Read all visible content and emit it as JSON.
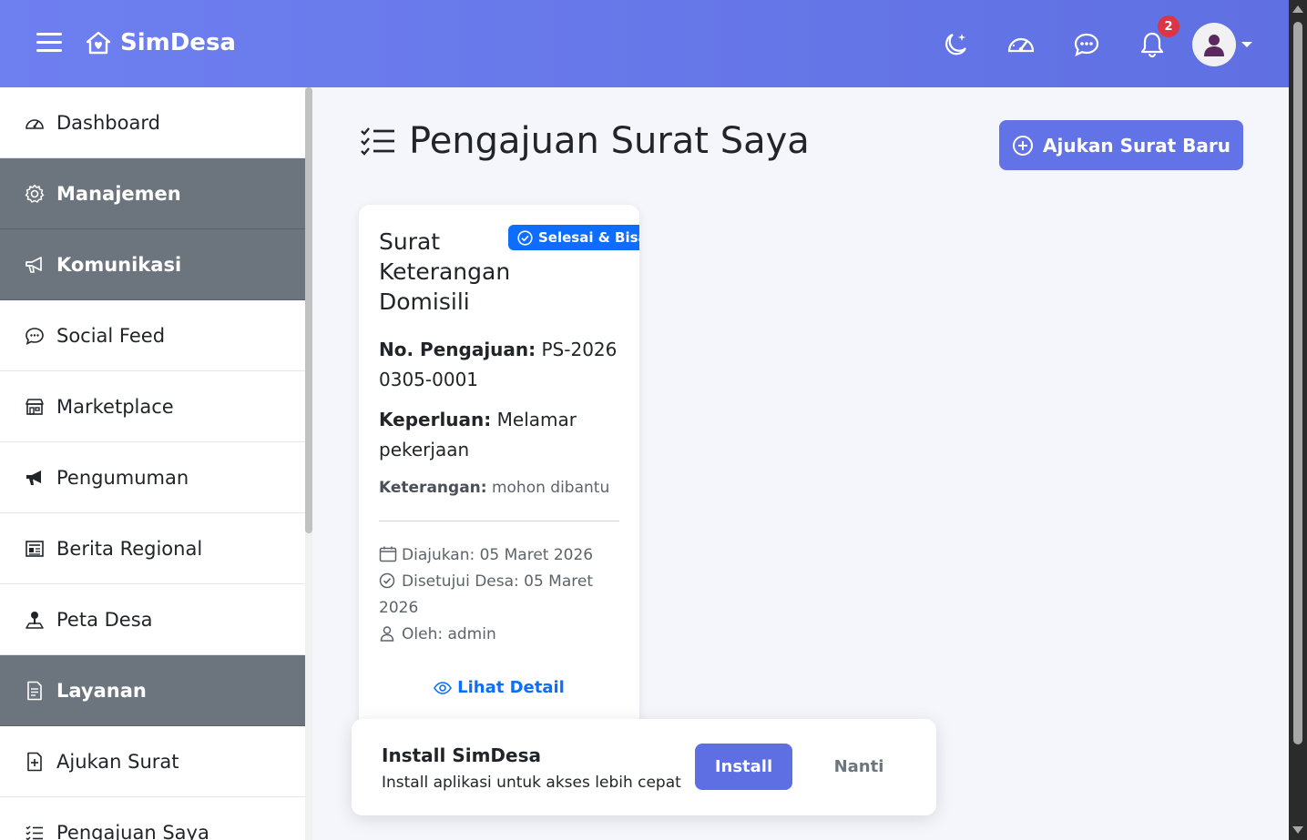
{
  "navbar": {
    "brand": "SimDesa",
    "notification_count": "2",
    "icons": [
      "menu-icon",
      "home-heart-icon",
      "moon-stars-icon",
      "speedometer-icon",
      "chat-dots-icon",
      "bell-icon",
      "user-avatar-icon"
    ],
    "accent_color": "#6173e6"
  },
  "sidebar": {
    "items": [
      {
        "label": "Dashboard",
        "icon": "speedometer-icon",
        "type": "link"
      },
      {
        "label": "Manajemen",
        "icon": "gear-icon",
        "type": "header"
      },
      {
        "label": "Komunikasi",
        "icon": "megaphone-icon",
        "type": "header"
      },
      {
        "label": "Social Feed",
        "icon": "chat-dots-icon",
        "type": "link"
      },
      {
        "label": "Marketplace",
        "icon": "shop-icon",
        "type": "link"
      },
      {
        "label": "Pengumuman",
        "icon": "megaphone-fill-icon",
        "type": "link"
      },
      {
        "label": "Berita Regional",
        "icon": "newspaper-icon",
        "type": "link"
      },
      {
        "label": "Peta Desa",
        "icon": "person-pin-icon",
        "type": "link"
      },
      {
        "label": "Layanan",
        "icon": "file-text-icon",
        "type": "header"
      },
      {
        "label": "Ajukan Surat",
        "icon": "file-plus-icon",
        "type": "link"
      },
      {
        "label": "Pengajuan Saya",
        "icon": "list-check-icon",
        "type": "link"
      }
    ]
  },
  "main": {
    "page_title": "Pengajuan Surat Saya",
    "new_button_label": "Ajukan Surat Baru",
    "card": {
      "status": "Selesai & Bisa Diunduh",
      "title": "Surat Keterangan Domisili",
      "no_label": "No. Pengajuan:",
      "no_value": "PS-20260305-0001",
      "purpose_label": "Keperluan:",
      "purpose_value": "Melamar pekerjaan",
      "note_label": "Keterangan:",
      "note_value": "mohon dibantu",
      "submitted": "Diajukan: 05 Maret 2026",
      "approved": "Disetujui Desa: 05 Maret 2026",
      "by": "Oleh: admin",
      "detail_link": "Lihat Detail"
    }
  },
  "install_prompt": {
    "title": "Install SimDesa",
    "subtitle": "Install aplikasi untuk akses lebih cepat",
    "install_label": "Install",
    "later_label": "Nanti"
  }
}
